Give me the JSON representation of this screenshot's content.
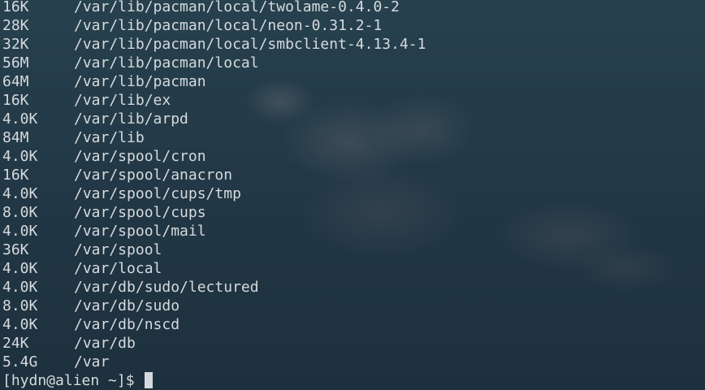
{
  "terminal": {
    "lines": [
      {
        "size": "16K",
        "path": "/var/lib/pacman/local/twolame-0.4.0-2"
      },
      {
        "size": "28K",
        "path": "/var/lib/pacman/local/neon-0.31.2-1"
      },
      {
        "size": "32K",
        "path": "/var/lib/pacman/local/smbclient-4.13.4-1"
      },
      {
        "size": "56M",
        "path": "/var/lib/pacman/local"
      },
      {
        "size": "64M",
        "path": "/var/lib/pacman"
      },
      {
        "size": "16K",
        "path": "/var/lib/ex"
      },
      {
        "size": "4.0K",
        "path": "/var/lib/arpd"
      },
      {
        "size": "84M",
        "path": "/var/lib"
      },
      {
        "size": "4.0K",
        "path": "/var/spool/cron"
      },
      {
        "size": "16K",
        "path": "/var/spool/anacron"
      },
      {
        "size": "4.0K",
        "path": "/var/spool/cups/tmp"
      },
      {
        "size": "8.0K",
        "path": "/var/spool/cups"
      },
      {
        "size": "4.0K",
        "path": "/var/spool/mail"
      },
      {
        "size": "36K",
        "path": "/var/spool"
      },
      {
        "size": "4.0K",
        "path": "/var/local"
      },
      {
        "size": "4.0K",
        "path": "/var/db/sudo/lectured"
      },
      {
        "size": "8.0K",
        "path": "/var/db/sudo"
      },
      {
        "size": "4.0K",
        "path": "/var/db/nscd"
      },
      {
        "size": "24K",
        "path": "/var/db"
      },
      {
        "size": "5.4G",
        "path": "/var"
      }
    ],
    "prompt": "[hydn@alien ~]$ ",
    "colors": {
      "text": "#d6dade",
      "background": "#223846"
    }
  }
}
